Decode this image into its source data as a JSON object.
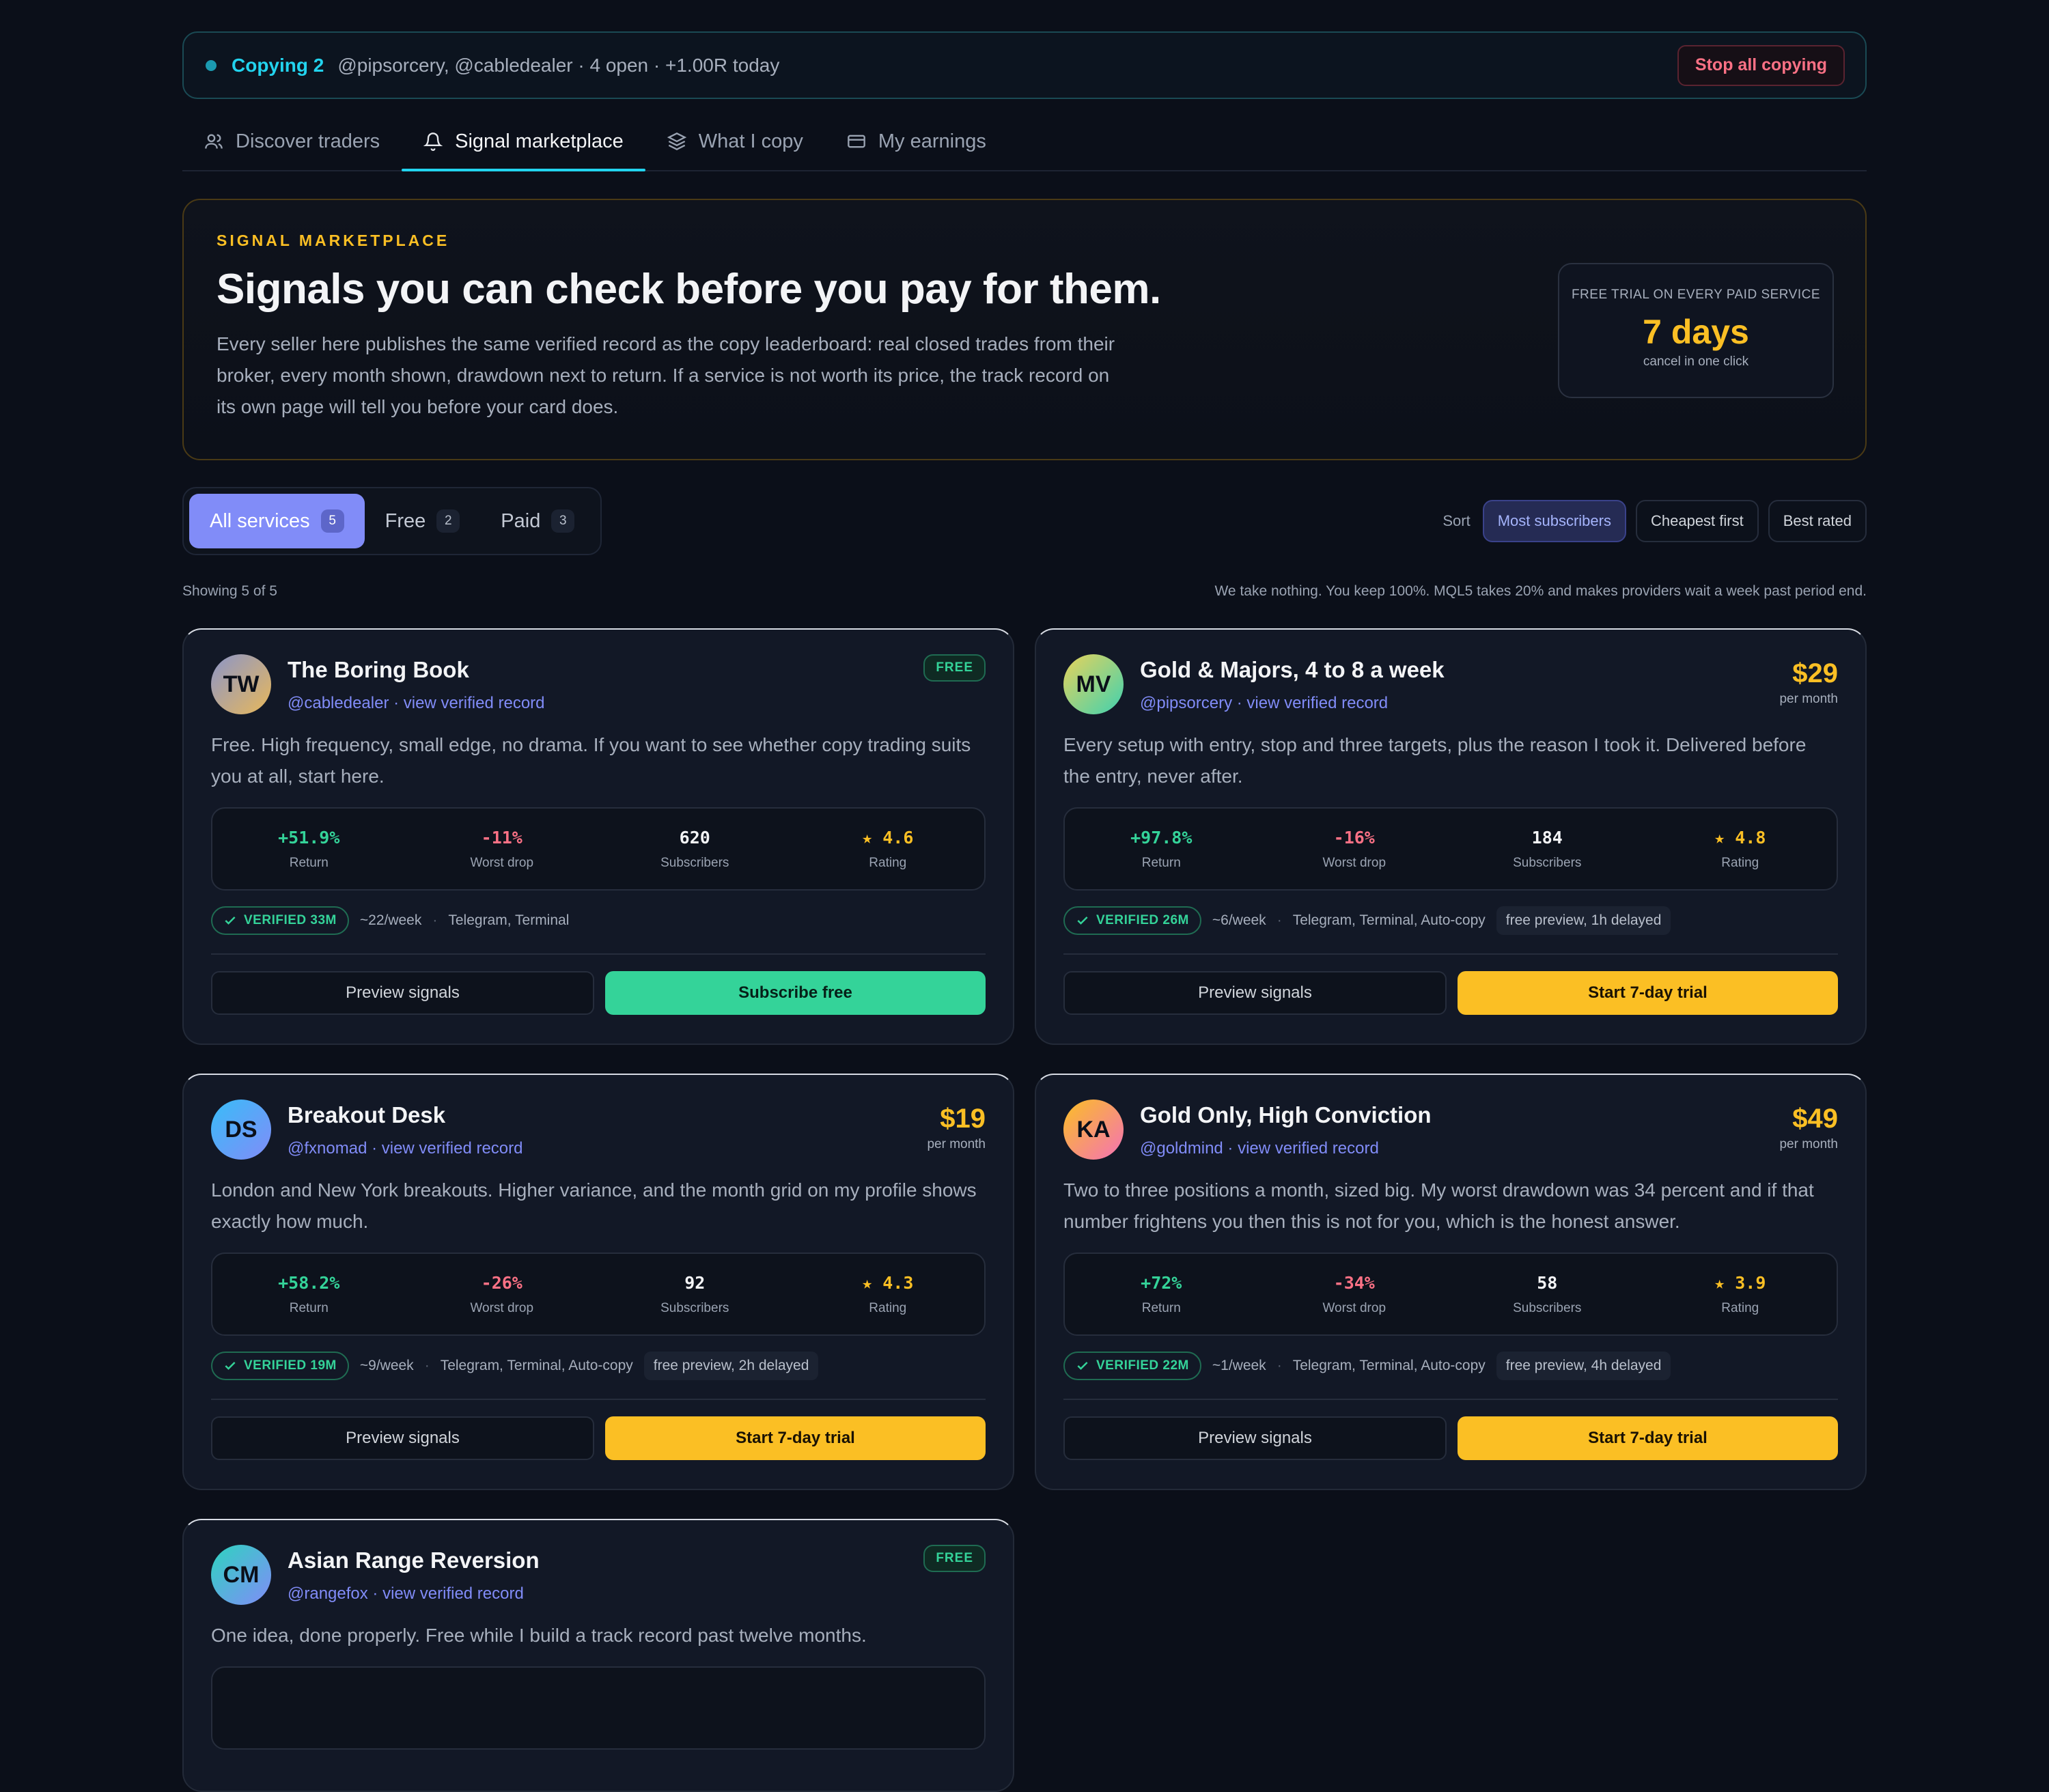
{
  "copybar": {
    "copying_label": "Copying 2",
    "meta": "@pipsorcery, @cabledealer · 4 open · +1.00R today",
    "stop_label": "Stop all copying"
  },
  "tabs": [
    {
      "label": "Discover traders",
      "icon": "users-icon",
      "active": false
    },
    {
      "label": "Signal marketplace",
      "icon": "bell-icon",
      "active": true
    },
    {
      "label": "What I copy",
      "icon": "layers-icon",
      "active": false
    },
    {
      "label": "My earnings",
      "icon": "card-icon",
      "active": false
    }
  ],
  "hero": {
    "eyebrow": "SIGNAL MARKETPLACE",
    "title": "Signals you can check before you pay for them.",
    "body": "Every seller here publishes the same verified record as the copy leaderboard: real closed trades from their broker, every month shown, drawdown next to return. If a service is not worth its price, the track record on its own page will tell you before your card does.",
    "trial_caption": "FREE TRIAL ON EVERY PAID SERVICE",
    "trial_value": "7 days",
    "trial_sub": "cancel in one click"
  },
  "filters": {
    "segments": [
      {
        "label": "All services",
        "count": "5",
        "active": true
      },
      {
        "label": "Free",
        "count": "2",
        "active": false
      },
      {
        "label": "Paid",
        "count": "3",
        "active": false
      }
    ],
    "sort_label": "Sort",
    "sort_options": [
      {
        "label": "Most subscribers",
        "active": true
      },
      {
        "label": "Cheapest first",
        "active": false
      },
      {
        "label": "Best rated",
        "active": false
      }
    ]
  },
  "info": {
    "showing": "Showing 5 of 5",
    "note": "We take nothing. You keep 100%. MQL5 takes 20% and makes providers wait a week past period end."
  },
  "labels": {
    "return": "Return",
    "worst_drop": "Worst drop",
    "subscribers": "Subscribers",
    "rating": "Rating",
    "per_month": "per month",
    "free_badge": "FREE",
    "preview_btn": "Preview signals"
  },
  "cards": [
    {
      "initials": "TW",
      "avatar_gradient": [
        "#8b95c9",
        "#e8b85a"
      ],
      "name": "The Boring Book",
      "handle": "@cabledealer · view verified record",
      "free": true,
      "price": "",
      "desc": "Free. High frequency, small edge, no drama. If you want to see whether copy trading suits you at all, start here.",
      "return": "+51.9%",
      "worst": "-11%",
      "subs": "620",
      "rating": "★ 4.6",
      "verified": "VERIFIED 33M",
      "freq": "~22/week",
      "channels": "Telegram, Terminal",
      "preview": "",
      "cta": "Subscribe free",
      "cta_style": "green"
    },
    {
      "initials": "MV",
      "avatar_gradient": [
        "#e9d35a",
        "#3fd1b0"
      ],
      "name": "Gold & Majors, 4 to 8 a week",
      "handle": "@pipsorcery · view verified record",
      "free": false,
      "price": "$29",
      "desc": "Every setup with entry, stop and three targets, plus the reason I took it. Delivered before the entry, never after.",
      "return": "+97.8%",
      "worst": "-16%",
      "subs": "184",
      "rating": "★ 4.8",
      "verified": "VERIFIED 26M",
      "freq": "~6/week",
      "channels": "Telegram, Terminal, Auto-copy",
      "preview": "free preview, 1h delayed",
      "cta": "Start 7-day trial",
      "cta_style": "yellow"
    },
    {
      "initials": "DS",
      "avatar_gradient": [
        "#38bdf8",
        "#818cf8"
      ],
      "name": "Breakout Desk",
      "handle": "@fxnomad · view verified record",
      "free": false,
      "price": "$19",
      "desc": "London and New York breakouts. Higher variance, and the month grid on my profile shows exactly how much.",
      "return": "+58.2%",
      "worst": "-26%",
      "subs": "92",
      "rating": "★ 4.3",
      "verified": "VERIFIED 19M",
      "freq": "~9/week",
      "channels": "Telegram, Terminal, Auto-copy",
      "preview": "free preview, 2h delayed",
      "cta": "Start 7-day trial",
      "cta_style": "yellow"
    },
    {
      "initials": "KA",
      "avatar_gradient": [
        "#fbbf24",
        "#f472b6"
      ],
      "name": "Gold Only, High Conviction",
      "handle": "@goldmind · view verified record",
      "free": false,
      "price": "$49",
      "desc": "Two to three positions a month, sized big. My worst drawdown was 34 percent and if that number frightens you then this is not for you, which is the honest answer.",
      "return": "+72%",
      "worst": "-34%",
      "subs": "58",
      "rating": "★ 3.9",
      "verified": "VERIFIED 22M",
      "freq": "~1/week",
      "channels": "Telegram, Terminal, Auto-copy",
      "preview": "free preview, 4h delayed",
      "cta": "Start 7-day trial",
      "cta_style": "yellow"
    },
    {
      "initials": "CM",
      "avatar_gradient": [
        "#2dd4bf",
        "#818cf8"
      ],
      "name": "Asian Range Reversion",
      "handle": "@rangefox · view verified record",
      "free": true,
      "price": "",
      "desc": "One idea, done properly. Free while I build a track record past twelve months.",
      "return": "",
      "worst": "",
      "subs": "",
      "rating": "",
      "verified": "",
      "freq": "",
      "channels": "",
      "preview": "",
      "cta": "",
      "cta_style": "green"
    }
  ],
  "colors": {
    "accent_cyan": "#22d3ee",
    "accent_indigo": "#818cf8",
    "gold": "#fbbf24",
    "green": "#34d399",
    "red": "#fb7185",
    "background": "#0b0f19"
  }
}
